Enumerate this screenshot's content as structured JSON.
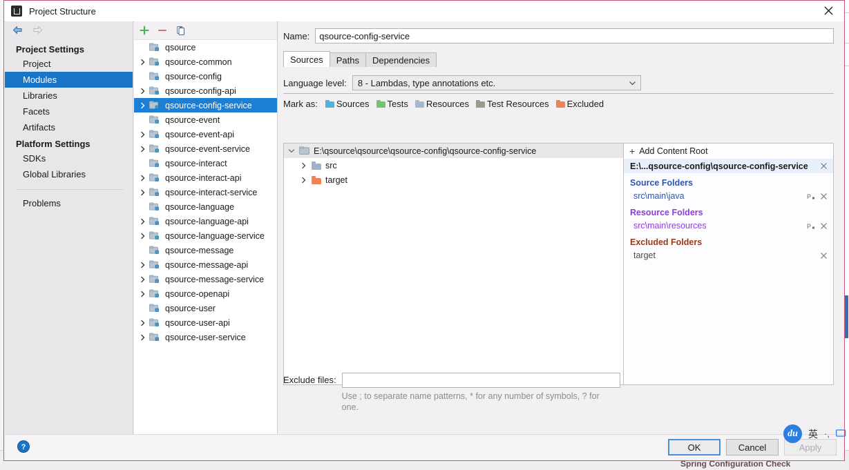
{
  "window": {
    "title": "Project Structure",
    "app_icon": "intellij-idea-icon",
    "close_icon": "close-icon"
  },
  "nav": {
    "back_icon": "arrow-back-icon",
    "forward_icon": "arrow-forward-icon"
  },
  "sidebar": {
    "groups": [
      {
        "label": "Project Settings",
        "items": [
          {
            "label": "Project",
            "selected": false
          },
          {
            "label": "Modules",
            "selected": true
          },
          {
            "label": "Libraries",
            "selected": false
          },
          {
            "label": "Facets",
            "selected": false
          },
          {
            "label": "Artifacts",
            "selected": false
          }
        ]
      },
      {
        "label": "Platform Settings",
        "items": [
          {
            "label": "SDKs",
            "selected": false
          },
          {
            "label": "Global Libraries",
            "selected": false
          }
        ]
      }
    ],
    "problems": {
      "label": "Problems"
    }
  },
  "modules_toolbar": {
    "add_icon": "plus-icon",
    "remove_icon": "minus-icon",
    "copy_icon": "copy-icon"
  },
  "modules": [
    {
      "label": "qsource",
      "expandable": false,
      "selected": false
    },
    {
      "label": "qsource-common",
      "expandable": true,
      "selected": false
    },
    {
      "label": "qsource-config",
      "expandable": false,
      "selected": false
    },
    {
      "label": "qsource-config-api",
      "expandable": true,
      "selected": false
    },
    {
      "label": "qsource-config-service",
      "expandable": true,
      "selected": true
    },
    {
      "label": "qsource-event",
      "expandable": false,
      "selected": false
    },
    {
      "label": "qsource-event-api",
      "expandable": true,
      "selected": false
    },
    {
      "label": "qsource-event-service",
      "expandable": true,
      "selected": false
    },
    {
      "label": "qsource-interact",
      "expandable": false,
      "selected": false
    },
    {
      "label": "qsource-interact-api",
      "expandable": true,
      "selected": false
    },
    {
      "label": "qsource-interact-service",
      "expandable": true,
      "selected": false
    },
    {
      "label": "qsource-language",
      "expandable": false,
      "selected": false
    },
    {
      "label": "qsource-language-api",
      "expandable": true,
      "selected": false
    },
    {
      "label": "qsource-language-service",
      "expandable": true,
      "selected": false
    },
    {
      "label": "qsource-message",
      "expandable": false,
      "selected": false
    },
    {
      "label": "qsource-message-api",
      "expandable": true,
      "selected": false
    },
    {
      "label": "qsource-message-service",
      "expandable": true,
      "selected": false
    },
    {
      "label": "qsource-openapi",
      "expandable": true,
      "selected": false
    },
    {
      "label": "qsource-user",
      "expandable": false,
      "selected": false
    },
    {
      "label": "qsource-user-api",
      "expandable": true,
      "selected": false
    },
    {
      "label": "qsource-user-service",
      "expandable": true,
      "selected": false
    }
  ],
  "details": {
    "name_label": "Name:",
    "name_value": "qsource-config-service",
    "tabs": [
      {
        "label": "Sources",
        "active": true
      },
      {
        "label": "Paths",
        "active": false
      },
      {
        "label": "Dependencies",
        "active": false
      }
    ],
    "language_level_label": "Language level:",
    "language_level_value": "8 - Lambdas, type annotations etc.",
    "language_level_caret": "chevron-down-icon",
    "mark_as_label": "Mark as:",
    "mark_as": [
      {
        "label": "Sources",
        "color": "#4fb3e0",
        "icon": "folder-sources-icon"
      },
      {
        "label": "Tests",
        "color": "#73c373",
        "icon": "folder-tests-icon"
      },
      {
        "label": "Resources",
        "color": "#a8b8cc",
        "icon": "folder-resources-icon"
      },
      {
        "label": "Test Resources",
        "color": "#9a9a8a",
        "icon": "folder-test-resources-icon"
      },
      {
        "label": "Excluded",
        "color": "#ef8354",
        "icon": "folder-excluded-icon"
      }
    ]
  },
  "content_tree": {
    "root": {
      "label": "E:\\qsource\\qsource\\qsource-config\\qsource-config-service",
      "expander_icon": "chevron-down-icon",
      "icon": "module-folder-icon"
    },
    "children": [
      {
        "label": "src",
        "color": "#9fb3c8",
        "icon": "folder-sources-icon",
        "expander_icon": "chevron-right-icon"
      },
      {
        "label": "target",
        "color": "#ef8354",
        "icon": "folder-excluded-icon",
        "expander_icon": "chevron-right-icon"
      }
    ]
  },
  "roots_panel": {
    "add_content_root": "Add Content Root",
    "add_icon": "plus-icon",
    "root_label": "E:\\...qsource-config\\qsource-config-service",
    "root_remove_icon": "close-icon",
    "sections": [
      {
        "title": "Source Folders",
        "title_color": "#2d55b3",
        "folders": [
          {
            "label": "src\\main\\java",
            "color": "#2d55b3",
            "package_icon": "package-prefix-icon",
            "remove_icon": "close-icon"
          }
        ]
      },
      {
        "title": "Resource Folders",
        "title_color": "#8b3fd6",
        "folders": [
          {
            "label": "src\\main\\resources",
            "color": "#8b3fd6",
            "package_icon": "package-prefix-icon",
            "remove_icon": "close-icon"
          }
        ]
      },
      {
        "title": "Excluded Folders",
        "title_color": "#9c3a17",
        "folders": [
          {
            "label": "target",
            "color": "#4a4a4a",
            "package_icon": null,
            "remove_icon": "close-icon"
          }
        ]
      }
    ]
  },
  "exclude": {
    "label": "Exclude files:",
    "value": "",
    "placeholder": "",
    "hint": "Use ; to separate name patterns, * for any number of symbols, ? for one."
  },
  "footer": {
    "help_icon": "help-icon",
    "ok": "OK",
    "cancel": "Cancel",
    "apply": "Apply"
  },
  "ime": {
    "logo": "du",
    "lang": "英",
    "punct_icon": "punctuation-icon",
    "keyboard_icon": "keyboard-icon"
  },
  "background": {
    "status_text": "Spring Configuration Check"
  },
  "colors": {
    "accent_selection": "#1d7fd4",
    "sidebar_selection": "#1974c8",
    "dialog_border": "#c2577a",
    "source_blue": "#2d55b3",
    "resource_purple": "#8b3fd6",
    "excluded_brown": "#9c3a17"
  }
}
